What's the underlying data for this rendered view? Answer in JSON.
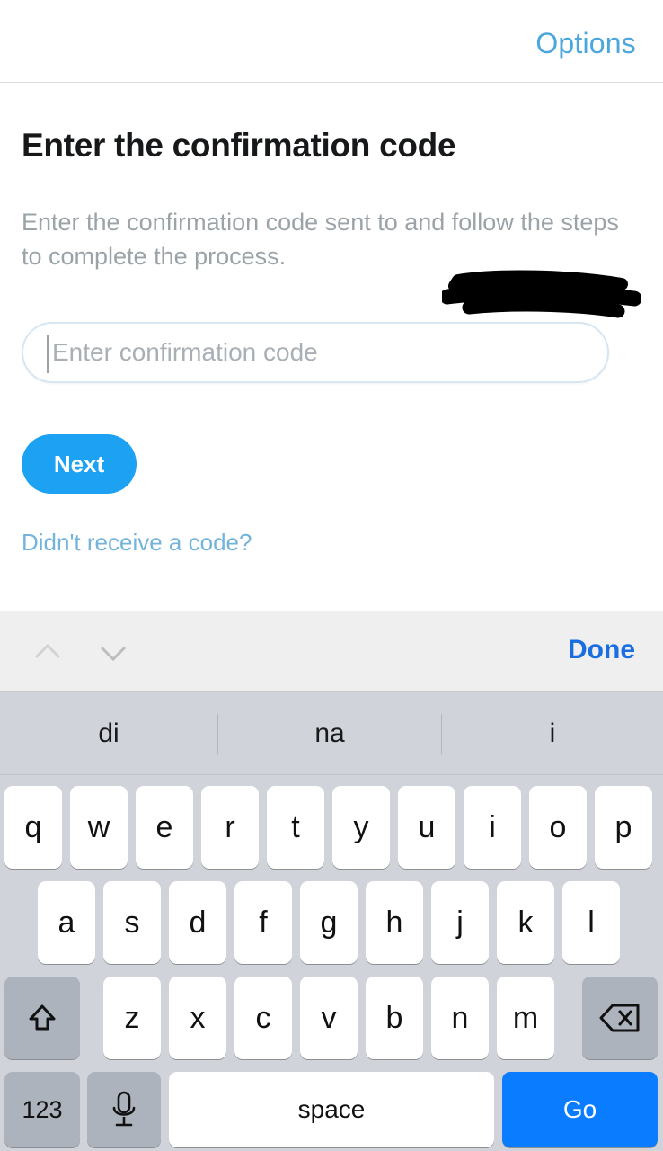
{
  "topbar": {
    "options_label": "Options"
  },
  "content": {
    "title": "Enter the confirmation code",
    "description": "Enter the confirmation code sent to and follow the steps to complete the process.",
    "redacted_note": "redacted-phone-or-email",
    "input": {
      "placeholder": "Enter confirmation code",
      "value": ""
    },
    "next_label": "Next",
    "resend_label": "Didn't receive a code?"
  },
  "accessory": {
    "prev_icon": "chevron-up-icon",
    "next_icon": "chevron-down-icon",
    "done_label": "Done"
  },
  "keyboard": {
    "predictions": [
      "di",
      "na",
      "i"
    ],
    "row1": [
      "q",
      "w",
      "e",
      "r",
      "t",
      "y",
      "u",
      "i",
      "o",
      "p"
    ],
    "row2": [
      "a",
      "s",
      "d",
      "f",
      "g",
      "h",
      "j",
      "k",
      "l"
    ],
    "row3": [
      "z",
      "x",
      "c",
      "v",
      "b",
      "n",
      "m"
    ],
    "shift_icon": "shift-arrow-icon",
    "backspace_icon": "backspace-icon",
    "numbers_label": "123",
    "mic_icon": "microphone-icon",
    "space_label": "space",
    "go_label": "Go"
  },
  "colors": {
    "accent_blue": "#1da1f2",
    "link_blue": "#4da7dd",
    "done_blue": "#1a6ee0",
    "go_blue": "#0a7cff",
    "keyboard_bg": "#d0d3d9",
    "accessory_bg": "#efeff0",
    "special_key": "#adb3bd",
    "muted_text": "#9aa3a8"
  }
}
